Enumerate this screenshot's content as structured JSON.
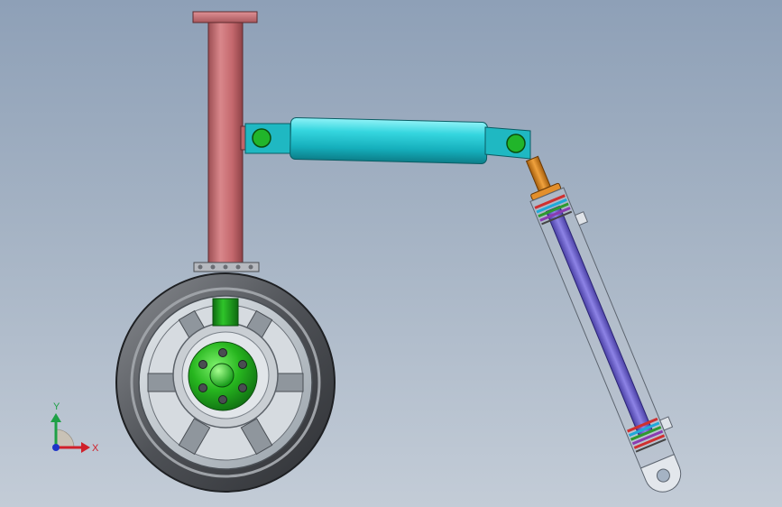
{
  "viewport": {
    "triad": {
      "x_label": "X",
      "y_label": "Y",
      "x_color": "#d0202a",
      "y_color": "#1ea046",
      "z_color": "#1e34c8"
    }
  },
  "model": {
    "components": [
      {
        "name": "strut-tube",
        "color": "#c7676b"
      },
      {
        "name": "top-flange",
        "color": "#c7676b"
      },
      {
        "name": "actuator-cylinder",
        "color": "#20c8d2"
      },
      {
        "name": "pivot-pin",
        "color": "#1fb42a"
      },
      {
        "name": "shock-absorber-housing",
        "color": "#b7c0cc"
      },
      {
        "name": "piston-rod",
        "color": "#6f64c8"
      },
      {
        "name": "rod-end-coupler",
        "color": "#d9881e"
      },
      {
        "name": "wheel-tire",
        "color": "#5a5d62"
      },
      {
        "name": "wheel-rim",
        "color": "#b9c0c6"
      },
      {
        "name": "wheel-hub",
        "color": "#2ac02a"
      }
    ]
  }
}
